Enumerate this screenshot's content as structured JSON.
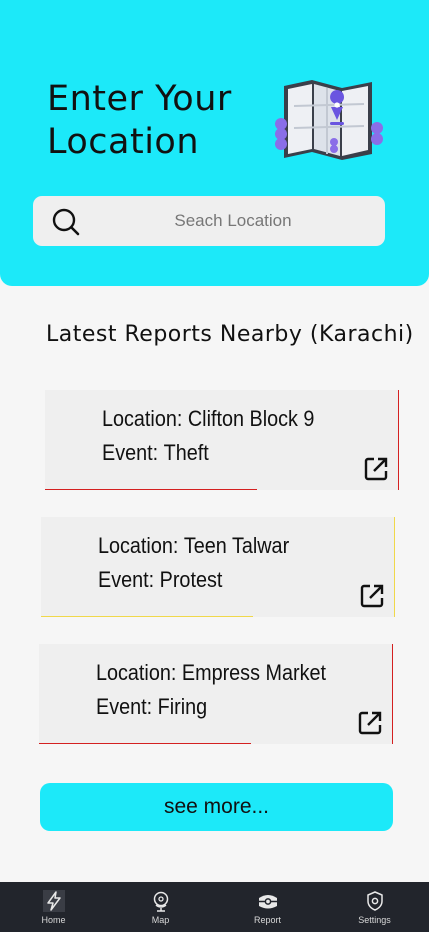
{
  "header": {
    "title": "Enter Your\nLocation"
  },
  "search": {
    "placeholder": "Seach Location"
  },
  "section": {
    "title": "Latest Reports Nearby (Karachi)"
  },
  "reports": [
    {
      "location_label": "Location: ",
      "location": "Clifton Block 9",
      "event_label": "Event: ",
      "event": "Theft",
      "accent": "#d42020"
    },
    {
      "location_label": "Location: ",
      "location": "Teen Talwar",
      "event_label": "Event: ",
      "event": "Protest",
      "accent": "#f0d84a"
    },
    {
      "location_label": "Location: ",
      "location": "Empress Market",
      "event_label": "Event: ",
      "event": "Firing",
      "accent": "#d42020"
    }
  ],
  "see_more_label": "see more...",
  "nav": {
    "items": [
      {
        "label": "Home",
        "icon": "lightning-icon"
      },
      {
        "label": "Map",
        "icon": "globe-pin-icon"
      },
      {
        "label": "Report",
        "icon": "report-icon"
      },
      {
        "label": "Settings",
        "icon": "shield-gear-icon"
      }
    ]
  },
  "colors": {
    "accent": "#1ce9f9",
    "nav_bg": "#22252c"
  }
}
